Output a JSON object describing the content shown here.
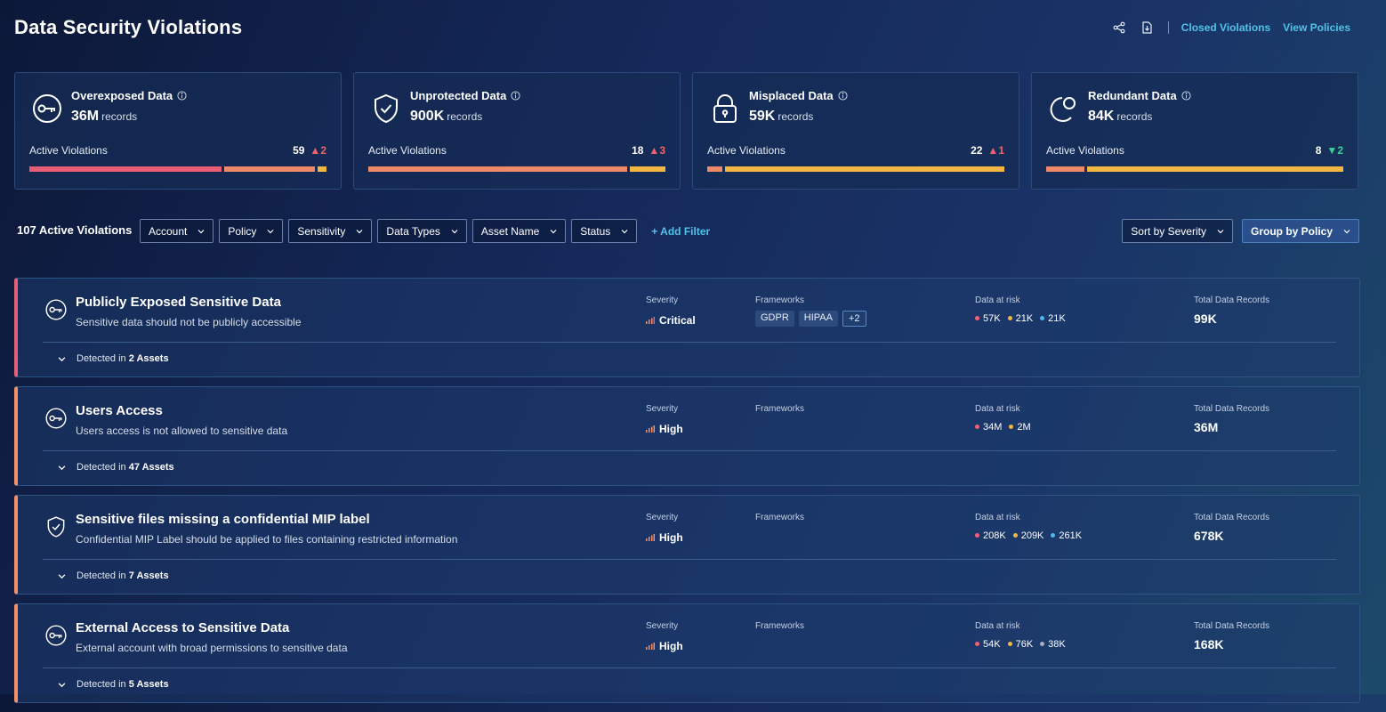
{
  "header": {
    "title": "Data Security Violations",
    "share_icon": "share-icon",
    "export_icon": "export-icon",
    "closed_violations": "Closed Violations",
    "view_policies": "View Policies"
  },
  "cards": [
    {
      "title": "Overexposed Data",
      "value": "36M",
      "unit": "records",
      "active_label": "Active Violations",
      "count": "59",
      "trend": "2",
      "trend_dir": "up",
      "icon": "key-icon",
      "bar": [
        {
          "frac": 0.66,
          "color": "#e85c74"
        },
        {
          "frac": 0.31,
          "color": "#ee8a68"
        },
        {
          "frac": 0.03,
          "color": "#f2b641"
        }
      ]
    },
    {
      "title": "Unprotected Data",
      "value": "900K",
      "unit": "records",
      "active_label": "Active Violations",
      "count": "18",
      "trend": "3",
      "trend_dir": "up",
      "icon": "shield-check-icon",
      "bar": [
        {
          "frac": 0.88,
          "color": "#ee8a68"
        },
        {
          "frac": 0.12,
          "color": "#f2b641"
        }
      ]
    },
    {
      "title": "Misplaced Data",
      "value": "59K",
      "unit": "records",
      "active_label": "Active Violations",
      "count": "22",
      "trend": "1",
      "trend_dir": "up",
      "icon": "lock-icon",
      "bar": [
        {
          "frac": 0.05,
          "color": "#ee8a68"
        },
        {
          "frac": 0.95,
          "color": "#f2b641"
        }
      ]
    },
    {
      "title": "Redundant Data",
      "value": "84K",
      "unit": "records",
      "active_label": "Active Violations",
      "count": "8",
      "trend": "2",
      "trend_dir": "down",
      "icon": "duplicate-icon",
      "bar": [
        {
          "frac": 0.13,
          "color": "#ee8a68"
        },
        {
          "frac": 0.87,
          "color": "#f2b641"
        }
      ]
    }
  ],
  "filters": {
    "count_label": "107 Active Violations",
    "items": [
      "Account",
      "Policy",
      "Sensitivity",
      "Data Types",
      "Asset Name",
      "Status"
    ],
    "add_filter": "+ Add Filter",
    "sort": "Sort by Severity",
    "group": "Group by Policy"
  },
  "columns": {
    "severity": "Severity",
    "frameworks": "Frameworks",
    "data_at_risk": "Data at risk",
    "total": "Total Data Records"
  },
  "colors": {
    "critical": "#e2617a",
    "high": "#f0916a",
    "pink": "#f2607a",
    "yellow": "#f2b641",
    "blue": "#4fb6ea",
    "gray": "#a7afbd"
  },
  "rows": [
    {
      "title": "Publicly Exposed Sensitive Data",
      "desc": "Sensitive data should not be publicly accessible",
      "severity": "Critical",
      "level": "critical",
      "frameworks": [
        "GDPR",
        "HIPAA",
        "+2"
      ],
      "risk": [
        {
          "v": "57K",
          "c": "pink"
        },
        {
          "v": "21K",
          "c": "yellow"
        },
        {
          "v": "21K",
          "c": "blue"
        }
      ],
      "total": "99K",
      "detected_prefix": "Detected in",
      "detected": "2 Assets",
      "icon": "key-icon"
    },
    {
      "title": "Users Access",
      "desc": "Users access is not allowed to sensitive data",
      "severity": "High",
      "level": "high",
      "frameworks": [],
      "risk": [
        {
          "v": "34M",
          "c": "pink"
        },
        {
          "v": "2M",
          "c": "yellow"
        }
      ],
      "total": "36M",
      "detected_prefix": "Detected in",
      "detected": "47 Assets",
      "icon": "key-icon"
    },
    {
      "title": "Sensitive files missing a confidential MIP label",
      "desc": "Confidential MIP Label should be applied to files containing restricted information",
      "severity": "High",
      "level": "high",
      "frameworks": [],
      "risk": [
        {
          "v": "208K",
          "c": "pink"
        },
        {
          "v": "209K",
          "c": "yellow"
        },
        {
          "v": "261K",
          "c": "blue"
        }
      ],
      "total": "678K",
      "detected_prefix": "Detected in",
      "detected": "7 Assets",
      "icon": "shield-check-icon"
    },
    {
      "title": "External Access to Sensitive Data",
      "desc": "External account with broad permissions to sensitive data",
      "severity": "High",
      "level": "high",
      "frameworks": [],
      "risk": [
        {
          "v": "54K",
          "c": "pink"
        },
        {
          "v": "76K",
          "c": "yellow"
        },
        {
          "v": "38K",
          "c": "gray"
        }
      ],
      "total": "168K",
      "detected_prefix": "Detected in",
      "detected": "5 Assets",
      "icon": "key-icon"
    }
  ]
}
